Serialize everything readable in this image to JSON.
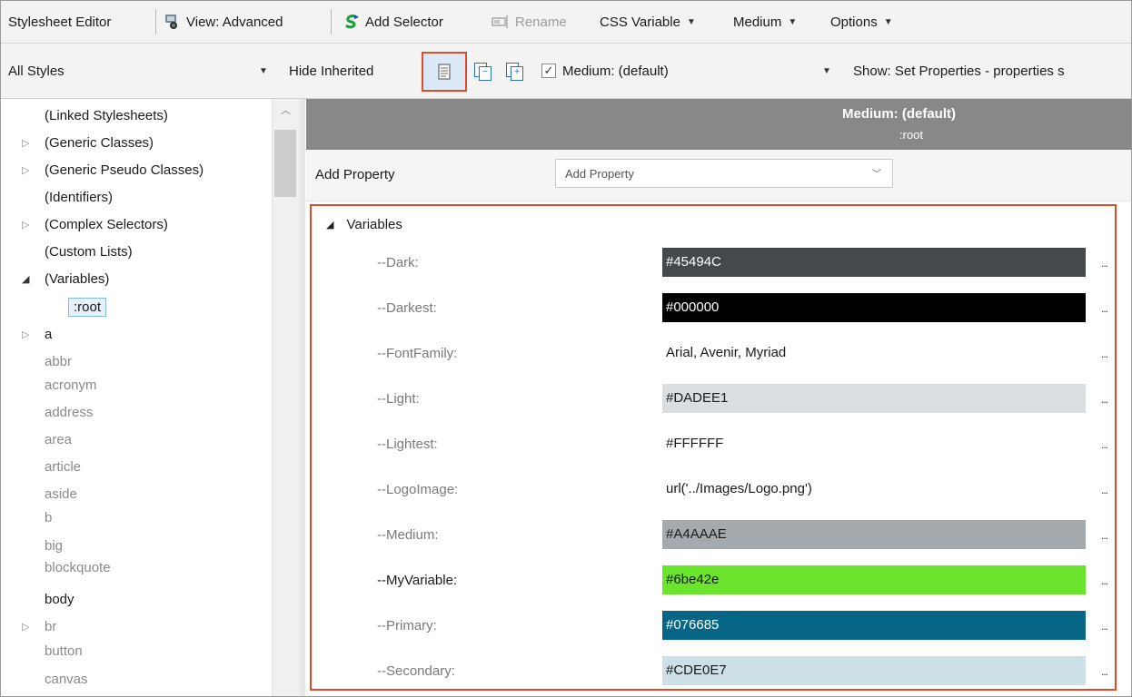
{
  "toolbar": {
    "title": "Stylesheet Editor",
    "view": "View: Advanced",
    "add_selector": "Add Selector",
    "rename": "Rename",
    "css_variable": "CSS Variable",
    "medium": "Medium",
    "options": "Options"
  },
  "filterbar": {
    "styles_select": "All Styles",
    "hide_inherited": "Hide Inherited",
    "medium_check": "Medium: (default)",
    "show": "Show: Set Properties - properties s"
  },
  "tree": {
    "items": [
      {
        "label": "(Linked Stylesheets)"
      },
      {
        "label": "(Generic Classes)"
      },
      {
        "label": "(Generic Pseudo Classes)"
      },
      {
        "label": "(Identifiers)"
      },
      {
        "label": "(Complex Selectors)"
      },
      {
        "label": "(Custom Lists)"
      },
      {
        "label": "(Variables)"
      },
      {
        "label": ":root"
      },
      {
        "label": "a"
      },
      {
        "label": "abbr"
      },
      {
        "label": "acronym"
      },
      {
        "label": "address"
      },
      {
        "label": "area"
      },
      {
        "label": "article"
      },
      {
        "label": "aside"
      },
      {
        "label": "b"
      },
      {
        "label": "big"
      },
      {
        "label": "blockquote"
      },
      {
        "label": "body"
      },
      {
        "label": "br"
      },
      {
        "label": "button"
      },
      {
        "label": "canvas"
      }
    ]
  },
  "panel": {
    "header_title": "Medium: (default)",
    "header_sub": ":root",
    "add_property_label": "Add Property",
    "add_property_placeholder": "Add Property",
    "section": "Variables"
  },
  "variables": [
    {
      "name": "--Dark:",
      "value": "#45494C",
      "bg": "#45494C",
      "fg": "#ffffff"
    },
    {
      "name": "--Darkest:",
      "value": "#000000",
      "bg": "#000000",
      "fg": "#ffffff"
    },
    {
      "name": "--FontFamily:",
      "value": "Arial, Avenir, Myriad",
      "bg": "#ffffff",
      "fg": "#1a1a1a"
    },
    {
      "name": "--Light:",
      "value": "#DADEE1",
      "bg": "#DADEE1",
      "fg": "#1a1a1a"
    },
    {
      "name": "--Lightest:",
      "value": "#FFFFFF",
      "bg": "#FFFFFF",
      "fg": "#1a1a1a"
    },
    {
      "name": "--LogoImage:",
      "value": "url('../Images/Logo.png')",
      "bg": "#ffffff",
      "fg": "#1a1a1a"
    },
    {
      "name": "--Medium:",
      "value": "#A4AAAE",
      "bg": "#A4AAAE",
      "fg": "#1a1a1a"
    },
    {
      "name": "--MyVariable:",
      "value": "#6be42e",
      "bg": "#6be42e",
      "fg": "#1a1a1a"
    },
    {
      "name": "--Primary:",
      "value": "#076685",
      "bg": "#076685",
      "fg": "#ffffff"
    },
    {
      "name": "--Secondary:",
      "value": "#CDE0E7",
      "bg": "#CDE0E7",
      "fg": "#1a1a1a"
    }
  ],
  "more_button": "..."
}
